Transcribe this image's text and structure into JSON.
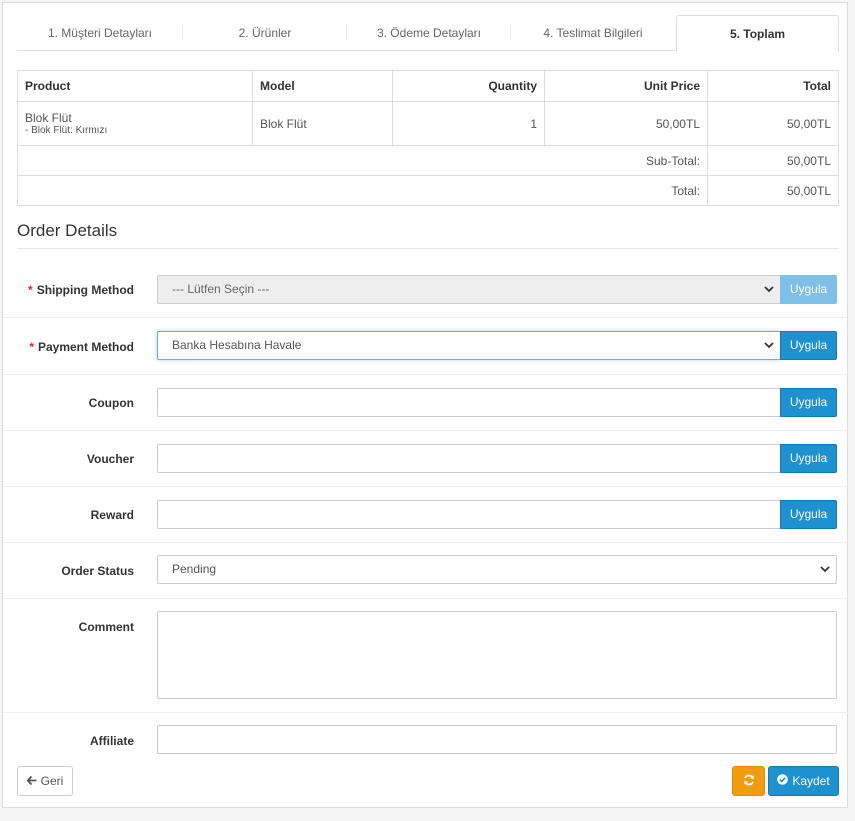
{
  "tabs": [
    {
      "label": "1. Müşteri Detayları"
    },
    {
      "label": "2. Ürünler"
    },
    {
      "label": "3. Ödeme Detayları"
    },
    {
      "label": "4. Teslimat Bilgileri"
    },
    {
      "label": "5. Toplam"
    }
  ],
  "table": {
    "headers": {
      "product": "Product",
      "model": "Model",
      "quantity": "Quantity",
      "unit_price": "Unit Price",
      "total": "Total"
    },
    "rows": [
      {
        "product": "Blok Flüt",
        "option": "- Blok Flüt: Kırmızı",
        "model": "Blok Flüt",
        "quantity": "1",
        "unit_price": "50,00TL",
        "total": "50,00TL"
      }
    ],
    "totals": [
      {
        "label": "Sub-Total:",
        "value": "50,00TL"
      },
      {
        "label": "Total:",
        "value": "50,00TL"
      }
    ]
  },
  "order_details": {
    "title": "Order Details",
    "required_mark": "*",
    "shipping_method": {
      "label": "Shipping Method",
      "value": "--- Lütfen Seçin ---",
      "button": "Uygula"
    },
    "payment_method": {
      "label": "Payment Method",
      "value": "Banka Hesabına Havale",
      "button": "Uygula"
    },
    "coupon": {
      "label": "Coupon",
      "value": "",
      "button": "Uygula"
    },
    "voucher": {
      "label": "Voucher",
      "value": "",
      "button": "Uygula"
    },
    "reward": {
      "label": "Reward",
      "value": "",
      "button": "Uygula"
    },
    "order_status": {
      "label": "Order Status",
      "value": "Pending"
    },
    "comment": {
      "label": "Comment",
      "value": ""
    },
    "affiliate": {
      "label": "Affiliate",
      "value": ""
    }
  },
  "footer": {
    "back_label": "Geri",
    "save_label": "Kaydet"
  },
  "colors": {
    "primary": "#1e91cf",
    "warning": "#f39c12",
    "required": "#e2241b"
  },
  "icons": {
    "back": "arrow-left-icon",
    "refresh": "refresh-icon",
    "save": "check-circle-icon",
    "select": "chevron-down-icon"
  }
}
